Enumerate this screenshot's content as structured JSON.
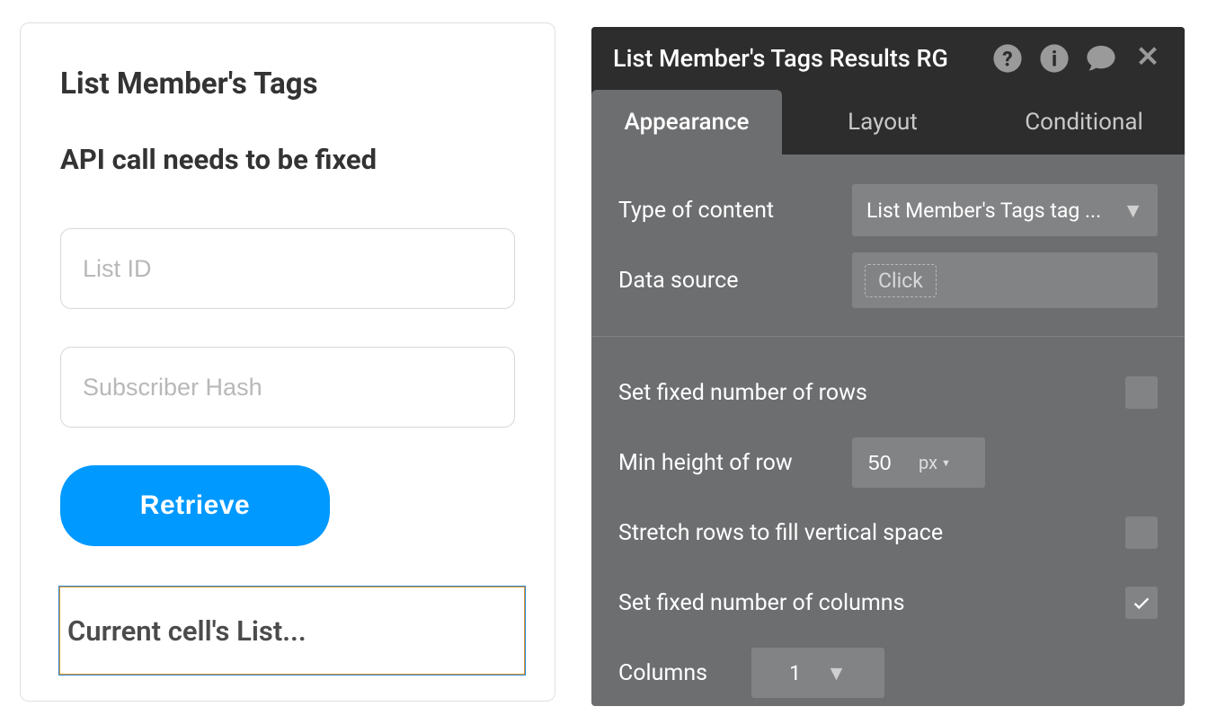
{
  "card": {
    "title": "List Member's Tags",
    "subtitle": "API call needs to be fixed",
    "list_id_placeholder": "List ID",
    "subscriber_placeholder": "Subscriber Hash",
    "retrieve_label": "Retrieve",
    "cell_text": "Current cell's List..."
  },
  "panel": {
    "title": "List Member's Tags Results RG",
    "tabs": {
      "appearance": "Appearance",
      "layout": "Layout",
      "conditional": "Conditional"
    },
    "type_of_content_label": "Type of content",
    "type_of_content_value": "List Member's Tags tag ...",
    "data_source_label": "Data source",
    "data_source_value": "Click",
    "fixed_rows_label": "Set fixed number of rows",
    "fixed_rows_checked": false,
    "min_height_label": "Min height of row",
    "min_height_value": "50",
    "min_height_unit": "px",
    "stretch_rows_label": "Stretch rows to fill vertical space",
    "stretch_rows_checked": false,
    "fixed_cols_label": "Set fixed number of columns",
    "fixed_cols_checked": true,
    "columns_label": "Columns",
    "columns_value": "1"
  }
}
